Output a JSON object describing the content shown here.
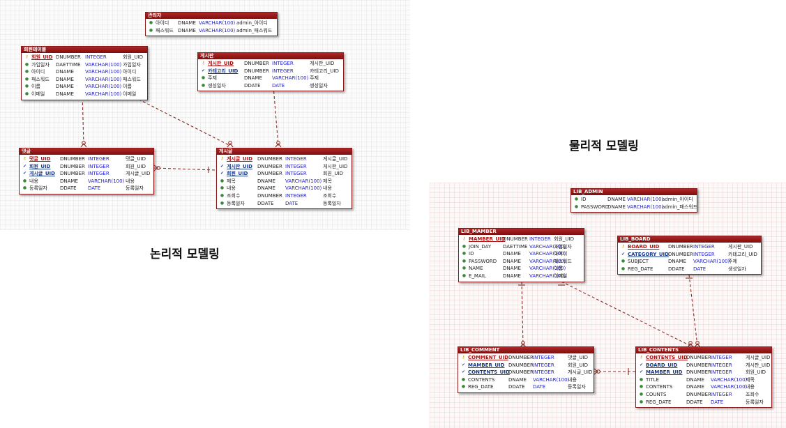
{
  "labels": {
    "logical": "논리적 모델링",
    "physical": "물리적 모델링"
  },
  "logical": {
    "admin": {
      "title": "관리자",
      "rows": [
        {
          "key": "col",
          "name": "아이디",
          "type": "DNAME",
          "dtype": "VARCHAR(100)",
          "comment": "admin_아이디"
        },
        {
          "key": "col",
          "name": "패스워드",
          "type": "DNAME",
          "dtype": "VARCHAR(100)",
          "comment": "admin_패스워드"
        }
      ]
    },
    "member": {
      "title": "회원테이블",
      "rows": [
        {
          "key": "pk",
          "name": "회원_UID",
          "type": "DNUMBER",
          "dtype": "INTEGER",
          "comment": "회원_UID"
        },
        {
          "key": "col",
          "name": "가입일자",
          "type": "DAETTIME",
          "dtype": "VARCHAR(100)",
          "comment": "가입일자"
        },
        {
          "key": "col",
          "name": "아이디",
          "type": "DNAME",
          "dtype": "VARCHAR(100)",
          "comment": "아이디"
        },
        {
          "key": "col",
          "name": "패스워드",
          "type": "DNAME",
          "dtype": "VARCHAR(100)",
          "comment": "패스워드"
        },
        {
          "key": "col",
          "name": "이름",
          "type": "DNAME",
          "dtype": "VARCHAR(100)",
          "comment": "이름"
        },
        {
          "key": "col",
          "name": "이메일",
          "type": "DNAME",
          "dtype": "VARCHAR(100)",
          "comment": "이메일"
        }
      ]
    },
    "board": {
      "title": "게시판",
      "rows": [
        {
          "key": "pk",
          "name": "게시판_UID",
          "type": "DNUMBER",
          "dtype": "INTEGER",
          "comment": "게시판_UID"
        },
        {
          "key": "fk",
          "name": "카테고리_UID",
          "type": "DNUMBER",
          "dtype": "INTEGER",
          "comment": "카테고리_UID"
        },
        {
          "key": "col",
          "name": "주제",
          "type": "DNAME",
          "dtype": "VARCHAR(100)",
          "comment": "주제"
        },
        {
          "key": "col",
          "name": "생성일자",
          "type": "DDATE",
          "dtype": "DATE",
          "comment": "생성일자"
        }
      ]
    },
    "comment": {
      "title": "댓글",
      "rows": [
        {
          "key": "pk",
          "name": "댓글_UID",
          "type": "DNUMBER",
          "dtype": "INTEGER",
          "comment": "댓글_UID"
        },
        {
          "key": "fk",
          "name": "회원_UID",
          "type": "DNUMBER",
          "dtype": "INTEGER",
          "comment": "회원_UID"
        },
        {
          "key": "fk",
          "name": "게시글_UID",
          "type": "DNUMBER",
          "dtype": "INTEGER",
          "comment": "게시글_UID"
        },
        {
          "key": "col",
          "name": "내용",
          "type": "DNAME",
          "dtype": "VARCHAR(100)",
          "comment": "내용"
        },
        {
          "key": "col",
          "name": "등록일자",
          "type": "DDATE",
          "dtype": "DATE",
          "comment": "등록일자"
        }
      ]
    },
    "post": {
      "title": "게시글",
      "rows": [
        {
          "key": "pk",
          "name": "게시글_UID",
          "type": "DNUMBER",
          "dtype": "INTEGER",
          "comment": "게시글_UID"
        },
        {
          "key": "fk",
          "name": "게시판_UID",
          "type": "DNUMBER",
          "dtype": "INTEGER",
          "comment": "게시판_UID"
        },
        {
          "key": "fk",
          "name": "회원_UID",
          "type": "DNUMBER",
          "dtype": "INTEGER",
          "comment": "회원_UID"
        },
        {
          "key": "col",
          "name": "제목",
          "type": "DNAME",
          "dtype": "VARCHAR(100)",
          "comment": "제목"
        },
        {
          "key": "col",
          "name": "내용",
          "type": "DNAME",
          "dtype": "VARCHAR(100)",
          "comment": "내용"
        },
        {
          "key": "col",
          "name": "조회수",
          "type": "DNUMBER",
          "dtype": "INTEGER",
          "comment": "조회수"
        },
        {
          "key": "col",
          "name": "등록일자",
          "type": "DDATE",
          "dtype": "DATE",
          "comment": "등록일자"
        }
      ]
    }
  },
  "physical": {
    "admin": {
      "title": "LIB_ADMIN",
      "rows": [
        {
          "key": "col",
          "name": "ID",
          "type": "DNAME",
          "dtype": "VARCHAR(100)",
          "comment": "admin_아이디"
        },
        {
          "key": "col",
          "name": "PASSWORD",
          "type": "DNAME",
          "dtype": "VARCHAR(100)",
          "comment": "admin_패스워드"
        }
      ]
    },
    "member": {
      "title": "LIB_MAMBER",
      "rows": [
        {
          "key": "pk",
          "name": "MAMBER_UID",
          "type": "DNUMBER",
          "dtype": "INTEGER",
          "comment": "회원_UID"
        },
        {
          "key": "col",
          "name": "JOIN_DAY",
          "type": "DAETTIME",
          "dtype": "VARCHAR(100)",
          "comment": "가입일자"
        },
        {
          "key": "col",
          "name": "ID",
          "type": "DNAME",
          "dtype": "VARCHAR(100)",
          "comment": "아이디"
        },
        {
          "key": "col",
          "name": "PASSWORD",
          "type": "DNAME",
          "dtype": "VARCHAR(100)",
          "comment": "패스워드"
        },
        {
          "key": "col",
          "name": "NAME",
          "type": "DNAME",
          "dtype": "VARCHAR(100)",
          "comment": "이름"
        },
        {
          "key": "col",
          "name": "E_MAIL",
          "type": "DNAME",
          "dtype": "VARCHAR(100)",
          "comment": "이메일"
        }
      ]
    },
    "board": {
      "title": "LIB_BOARD",
      "rows": [
        {
          "key": "pk",
          "name": "BOARD_UID",
          "type": "DNUMBER",
          "dtype": "INTEGER",
          "comment": "게시판_UID"
        },
        {
          "key": "fk",
          "name": "CATEGORY_UID",
          "type": "DNUMBER",
          "dtype": "INTEGER",
          "comment": "카테고리_UID"
        },
        {
          "key": "col",
          "name": "SUBJECT",
          "type": "DNAME",
          "dtype": "VARCHAR(100)",
          "comment": "주제"
        },
        {
          "key": "col",
          "name": "REG_DATE",
          "type": "DDATE",
          "dtype": "DATE",
          "comment": "생성일자"
        }
      ]
    },
    "comment": {
      "title": "LIB_COMMENT",
      "rows": [
        {
          "key": "pk",
          "name": "COMMENT_UID",
          "type": "DNUMBER",
          "dtype": "INTEGER",
          "comment": "댓글_UID"
        },
        {
          "key": "fk",
          "name": "MAMBER_UID",
          "type": "DNUMBER",
          "dtype": "INTEGER",
          "comment": "회원_UID"
        },
        {
          "key": "fk",
          "name": "CONTENTS_UID",
          "type": "DNUMBER",
          "dtype": "INTEGER",
          "comment": "게시글_UID"
        },
        {
          "key": "col",
          "name": "CONTENTS",
          "type": "DNAME",
          "dtype": "VARCHAR(100)",
          "comment": "내용"
        },
        {
          "key": "col",
          "name": "REG_DATE",
          "type": "DDATE",
          "dtype": "DATE",
          "comment": "등록일자"
        }
      ]
    },
    "contents": {
      "title": "LIB_CONTENTS",
      "rows": [
        {
          "key": "pk",
          "name": "CONTENTS_UID",
          "type": "DNUMBER",
          "dtype": "INTEGER",
          "comment": "게시글_UID"
        },
        {
          "key": "fk",
          "name": "BOARD_UID",
          "type": "DNUMBER",
          "dtype": "INTEGER",
          "comment": "게시판_UID"
        },
        {
          "key": "fk",
          "name": "MAMBER_UID",
          "type": "DNUMBER",
          "dtype": "INTEGER",
          "comment": "회원_UID"
        },
        {
          "key": "col",
          "name": "TITLE",
          "type": "DNAME",
          "dtype": "VARCHAR(100)",
          "comment": "제목"
        },
        {
          "key": "col",
          "name": "CONTENTS",
          "type": "DNAME",
          "dtype": "VARCHAR(100)",
          "comment": "내용"
        },
        {
          "key": "col",
          "name": "COUNTS",
          "type": "DNUMBER",
          "dtype": "INTEGER",
          "comment": "조회수"
        },
        {
          "key": "col",
          "name": "REG_DATE",
          "type": "DDATE",
          "dtype": "DATE",
          "comment": "등록일자"
        }
      ]
    }
  }
}
